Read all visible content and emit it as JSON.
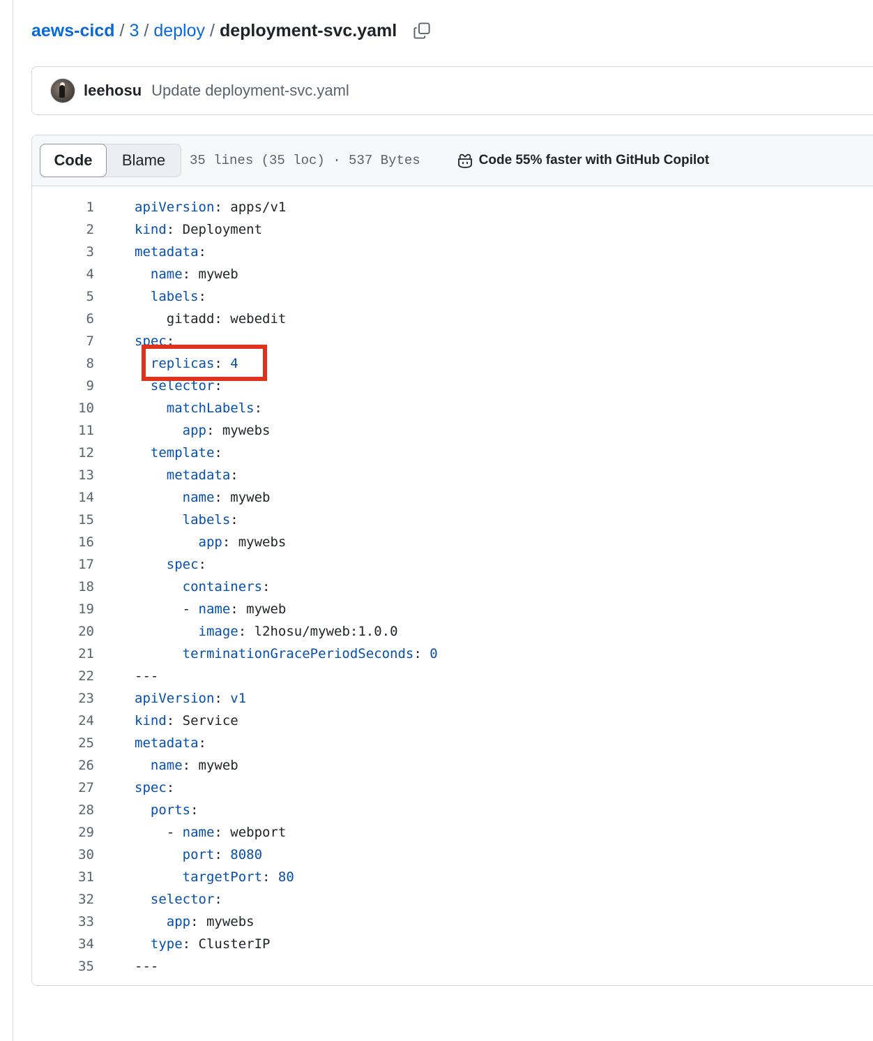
{
  "breadcrumb": {
    "repo": "aews-cicd",
    "sep": "/",
    "folder1": "3",
    "folder2": "deploy",
    "file": "deployment-svc.yaml",
    "copy_icon": "copy-icon"
  },
  "commit": {
    "author": "leehosu",
    "message": "Update deployment-svc.yaml"
  },
  "file_header": {
    "tabs": [
      "Code",
      "Blame"
    ],
    "active_tab": "Code",
    "stats": "35 lines (35 loc) · 537 Bytes",
    "copilot_label": "Code 55% faster with GitHub Copilot",
    "copilot_icon": "copilot-icon"
  },
  "colors": {
    "link": "#0969da",
    "key": "#0550ae",
    "highlight": "#e0311c"
  },
  "code_lines": [
    {
      "n": "1",
      "indent": "",
      "key": "apiVersion",
      "sep": ": ",
      "value": "apps/v1"
    },
    {
      "n": "2",
      "indent": "",
      "key": "kind",
      "sep": ": ",
      "value": "Deployment"
    },
    {
      "n": "3",
      "indent": "",
      "key": "metadata",
      "sep": ":",
      "value": ""
    },
    {
      "n": "4",
      "indent": "  ",
      "key": "name",
      "sep": ": ",
      "value": "myweb"
    },
    {
      "n": "5",
      "indent": "  ",
      "key": "labels",
      "sep": ":",
      "value": ""
    },
    {
      "n": "6",
      "indent": "    ",
      "key": "",
      "sep": "",
      "value": "gitadd: webedit"
    },
    {
      "n": "7",
      "indent": "",
      "key": "spec",
      "sep": ":",
      "value": ""
    },
    {
      "n": "8",
      "indent": "  ",
      "key": "replicas",
      "sep": ": ",
      "value": "4",
      "num": true
    },
    {
      "n": "9",
      "indent": "  ",
      "key": "selector",
      "sep": ":",
      "value": ""
    },
    {
      "n": "10",
      "indent": "    ",
      "key": "matchLabels",
      "sep": ":",
      "value": ""
    },
    {
      "n": "11",
      "indent": "      ",
      "key": "app",
      "sep": ": ",
      "value": "mywebs"
    },
    {
      "n": "12",
      "indent": "  ",
      "key": "template",
      "sep": ":",
      "value": ""
    },
    {
      "n": "13",
      "indent": "    ",
      "key": "metadata",
      "sep": ":",
      "value": ""
    },
    {
      "n": "14",
      "indent": "      ",
      "key": "name",
      "sep": ": ",
      "value": "myweb"
    },
    {
      "n": "15",
      "indent": "      ",
      "key": "labels",
      "sep": ":",
      "value": ""
    },
    {
      "n": "16",
      "indent": "        ",
      "key": "app",
      "sep": ": ",
      "value": "mywebs"
    },
    {
      "n": "17",
      "indent": "    ",
      "key": "spec",
      "sep": ":",
      "value": ""
    },
    {
      "n": "18",
      "indent": "      ",
      "key": "containers",
      "sep": ":",
      "value": ""
    },
    {
      "n": "19",
      "indent": "      - ",
      "key": "name",
      "sep": ": ",
      "value": "myweb"
    },
    {
      "n": "20",
      "indent": "        ",
      "key": "image",
      "sep": ": ",
      "value": "l2hosu/myweb:1.0.0"
    },
    {
      "n": "21",
      "indent": "      ",
      "key": "terminationGracePeriodSeconds",
      "sep": ": ",
      "value": "0",
      "num": true
    },
    {
      "n": "22",
      "indent": "",
      "key": "",
      "sep": "",
      "value": "---"
    },
    {
      "n": "23",
      "indent": "",
      "key": "apiVersion",
      "sep": ": ",
      "value": "v1",
      "num": true
    },
    {
      "n": "24",
      "indent": "",
      "key": "kind",
      "sep": ": ",
      "value": "Service"
    },
    {
      "n": "25",
      "indent": "",
      "key": "metadata",
      "sep": ":",
      "value": ""
    },
    {
      "n": "26",
      "indent": "  ",
      "key": "name",
      "sep": ": ",
      "value": "myweb"
    },
    {
      "n": "27",
      "indent": "",
      "key": "spec",
      "sep": ":",
      "value": ""
    },
    {
      "n": "28",
      "indent": "  ",
      "key": "ports",
      "sep": ":",
      "value": ""
    },
    {
      "n": "29",
      "indent": "    - ",
      "key": "name",
      "sep": ": ",
      "value": "webport"
    },
    {
      "n": "30",
      "indent": "      ",
      "key": "port",
      "sep": ": ",
      "value": "8080",
      "num": true
    },
    {
      "n": "31",
      "indent": "      ",
      "key": "targetPort",
      "sep": ": ",
      "value": "80",
      "num": true
    },
    {
      "n": "32",
      "indent": "  ",
      "key": "selector",
      "sep": ":",
      "value": ""
    },
    {
      "n": "33",
      "indent": "    ",
      "key": "app",
      "sep": ": ",
      "value": "mywebs"
    },
    {
      "n": "34",
      "indent": "  ",
      "key": "type",
      "sep": ": ",
      "value": "ClusterIP"
    },
    {
      "n": "35",
      "indent": "",
      "key": "",
      "sep": "",
      "value": "---"
    }
  ],
  "annotation": {
    "highlighted_line": "8"
  }
}
